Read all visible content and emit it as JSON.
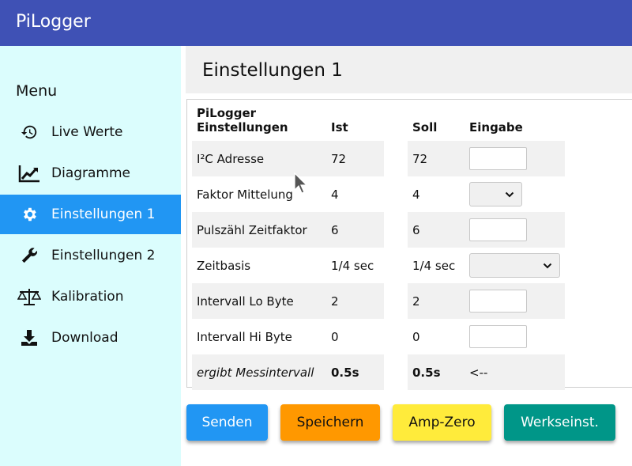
{
  "app": {
    "title": "PiLogger"
  },
  "sidebar": {
    "menu_title": "Menu",
    "items": [
      {
        "label": "Live Werte",
        "icon": "history-icon"
      },
      {
        "label": "Diagramme",
        "icon": "chart-line-icon"
      },
      {
        "label": "Einstellungen 1",
        "icon": "gear-icon",
        "active": true
      },
      {
        "label": "Einstellungen 2",
        "icon": "wrench-icon"
      },
      {
        "label": "Kalibration",
        "icon": "balance-scale-icon"
      },
      {
        "label": "Download",
        "icon": "download-icon"
      }
    ]
  },
  "main": {
    "title": "Einstellungen 1",
    "table": {
      "headers": {
        "setting": "PiLogger\nEinstellungen",
        "ist": "Ist",
        "soll": "Soll",
        "eingabe": "Eingabe"
      },
      "rows": [
        {
          "label": "I²C Adresse",
          "ist": "72",
          "soll": "72",
          "input": "text"
        },
        {
          "label": "Faktor Mittelung",
          "ist": "4",
          "soll": "4",
          "input": "select"
        },
        {
          "label": "Pulszähl Zeitfaktor",
          "ist": "6",
          "soll": "6",
          "input": "text"
        },
        {
          "label": "Zeitbasis",
          "ist": "1/4 sec",
          "soll": "1/4 sec",
          "input": "select"
        },
        {
          "label": "Intervall Lo Byte",
          "ist": "2",
          "soll": "2",
          "input": "text"
        },
        {
          "label": "Intervall Hi Byte",
          "ist": "0",
          "soll": "0",
          "input": "text"
        },
        {
          "label": "ergibt Messintervall",
          "ist": "0.5s",
          "soll": "0.5s",
          "eingabe": "<--"
        }
      ]
    },
    "buttons": {
      "send": {
        "label": "Senden",
        "color": "#2196f3"
      },
      "save": {
        "label": "Speichern",
        "color": "#ff9800"
      },
      "amp_zero": {
        "label": "Amp-Zero",
        "color": "#ffeb3b"
      },
      "factory": {
        "label": "Werkseinst.",
        "color": "#009688"
      }
    }
  }
}
